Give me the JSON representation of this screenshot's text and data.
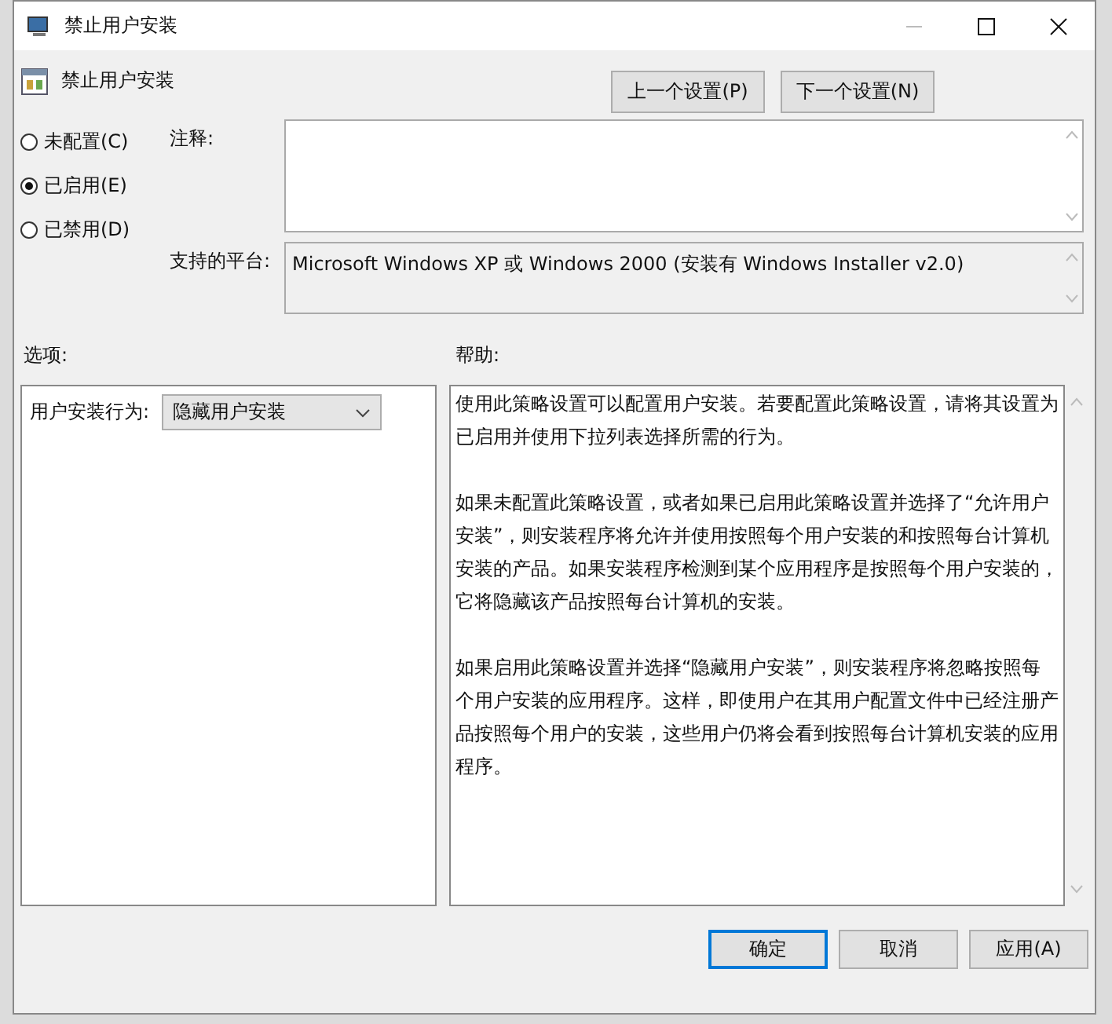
{
  "window": {
    "title": "禁止用户安装"
  },
  "header": {
    "policy_name": "禁止用户安装",
    "buttons": [
      "上一个设置(P)",
      "下一个设置(N)"
    ]
  },
  "state_options": [
    {
      "label": "未配置(C)",
      "selected": false
    },
    {
      "label": "已启用(E)",
      "selected": true
    },
    {
      "label": "已禁用(D)",
      "selected": false
    }
  ],
  "comment": {
    "label": "注释:"
  },
  "supported_on": {
    "label": "支持的平台:",
    "value": "Microsoft Windows XP 或 Windows 2000 (安装有 Windows Installer v2.0)"
  },
  "options": {
    "label": "选项:",
    "items": [
      {
        "label": "用户安装行为:",
        "value": "隐藏用户安装"
      }
    ]
  },
  "help": {
    "label": "帮助:",
    "paragraphs": [
      "使用此策略设置可以配置用户安装。若要配置此策略设置，请将其设置为已启用并使用下拉列表选择所需的行为。",
      "如果未配置此策略设置，或者如果已启用此策略设置并选择了“允许用户安装”，则安装程序将允许并使用按照每个用户安装的和按照每台计算机安装的产品。如果安装程序检测到某个应用程序是按照每个用户安装的，它将隐藏该产品按照每台计算机的安装。",
      "如果启用此策略设置并选择“隐藏用户安装”，则安装程序将忽略按照每个用户安装的应用程序。这样，即使用户在其用户配置文件中已经注册产品按照每个用户的安装，这些用户仍将会看到按照每台计算机安装的应用程序。"
    ]
  },
  "buttons": [
    {
      "label": "确定",
      "default": true
    },
    {
      "label": "取消",
      "default": false
    },
    {
      "label": "应用(A)",
      "default": false
    }
  ]
}
